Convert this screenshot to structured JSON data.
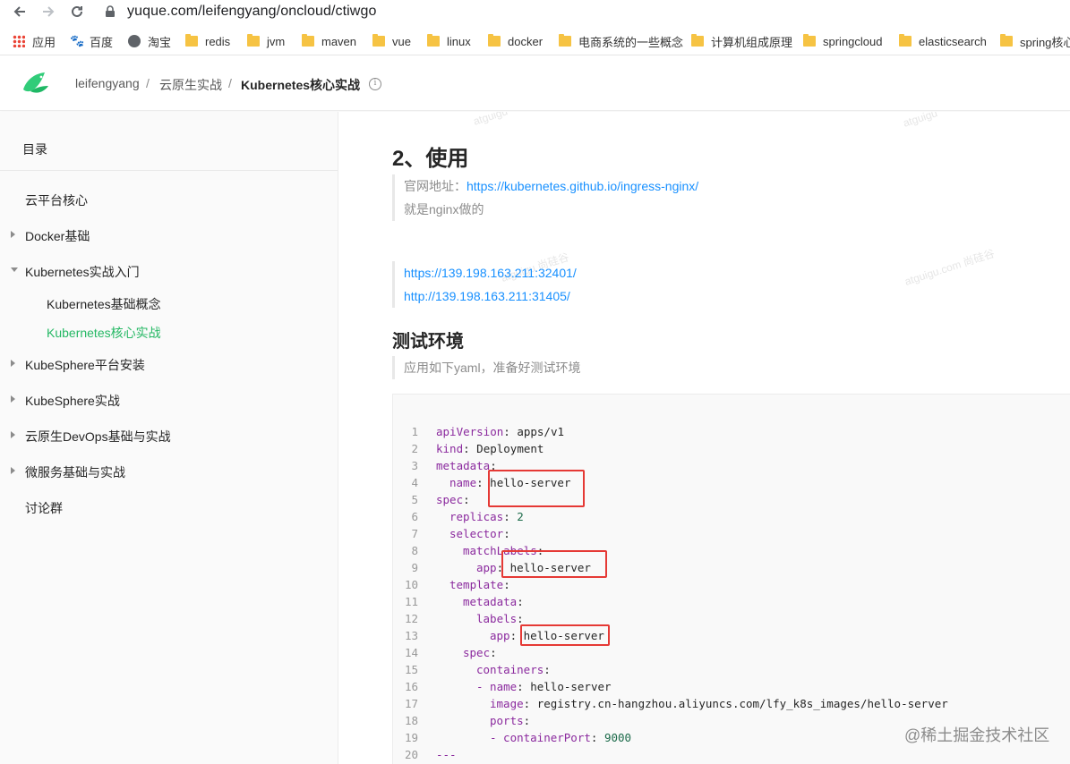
{
  "browser": {
    "url": "yuque.com/leifengyang/oncloud/ctiwgo",
    "bookmarks": [
      "应用",
      "百度",
      "淘宝",
      "redis",
      "jvm",
      "maven",
      "vue",
      "linux",
      "docker",
      "电商系统的一些概念",
      "计算机组成原理",
      "springcloud",
      "elasticsearch",
      "spring核心"
    ]
  },
  "header": {
    "breadcrumb": [
      "leifengyang",
      "云原生实战",
      "Kubernetes核心实战"
    ]
  },
  "sidebar": {
    "title": "目录",
    "items": [
      {
        "label": "云平台核心"
      },
      {
        "label": "Docker基础"
      },
      {
        "label": "Kubernetes实战入门"
      },
      {
        "label": "Kubernetes基础概念"
      },
      {
        "label": "Kubernetes核心实战"
      },
      {
        "label": "KubeSphere平台安装"
      },
      {
        "label": "KubeSphere实战"
      },
      {
        "label": "云原生DevOps基础与实战"
      },
      {
        "label": "微服务基础与实战"
      },
      {
        "label": "讨论群"
      }
    ]
  },
  "content": {
    "heading": "2、使用",
    "quote1_prefix": "官网地址：",
    "quote1_link": "https://kubernetes.github.io/ingress-nginx/",
    "quote1_line2": "就是nginx做的",
    "links": [
      "https://139.198.163.211:32401/",
      "http://139.198.163.211:31405/"
    ],
    "subheading": "测试环境",
    "quote2": "应用如下yaml，准备好测试环境",
    "watermarks": [
      "atguigu",
      "atguigu",
      "atguigu 尚硅谷",
      "atguigu.com 尚硅谷"
    ],
    "code": [
      {
        "n": "1",
        "key": "apiVersion",
        "val": "apps/v1"
      },
      {
        "n": "2",
        "key": "kind",
        "val": "Deployment"
      },
      {
        "n": "3",
        "key": "metadata",
        "val": ""
      },
      {
        "n": "4",
        "key": "name",
        "val": "hello-server"
      },
      {
        "n": "5",
        "key": "spec",
        "val": ""
      },
      {
        "n": "6",
        "key": "replicas",
        "val": "2"
      },
      {
        "n": "7",
        "key": "selector",
        "val": ""
      },
      {
        "n": "8",
        "key": "matchLabels",
        "val": ""
      },
      {
        "n": "9",
        "key": "app",
        "val": "hello-server"
      },
      {
        "n": "10",
        "key": "template",
        "val": ""
      },
      {
        "n": "11",
        "key": "metadata",
        "val": ""
      },
      {
        "n": "12",
        "key": "labels",
        "val": ""
      },
      {
        "n": "13",
        "key": "app",
        "val": "hello-server"
      },
      {
        "n": "14",
        "key": "spec",
        "val": ""
      },
      {
        "n": "15",
        "key": "containers",
        "val": ""
      },
      {
        "n": "16",
        "key": "- name",
        "val": "hello-server"
      },
      {
        "n": "17",
        "key": "image",
        "val": "registry.cn-hangzhou.aliyuncs.com/lfy_k8s_images/hello-server"
      },
      {
        "n": "18",
        "key": "ports",
        "val": ""
      },
      {
        "n": "19",
        "key": "- containerPort",
        "val": "9000"
      },
      {
        "n": "20",
        "key": "---",
        "val": ""
      }
    ]
  },
  "footer_watermark": "@稀土掘金技术社区",
  "colors": {
    "accent": "#25b864",
    "highlight": "#e53935",
    "link": "#4a90c4"
  }
}
